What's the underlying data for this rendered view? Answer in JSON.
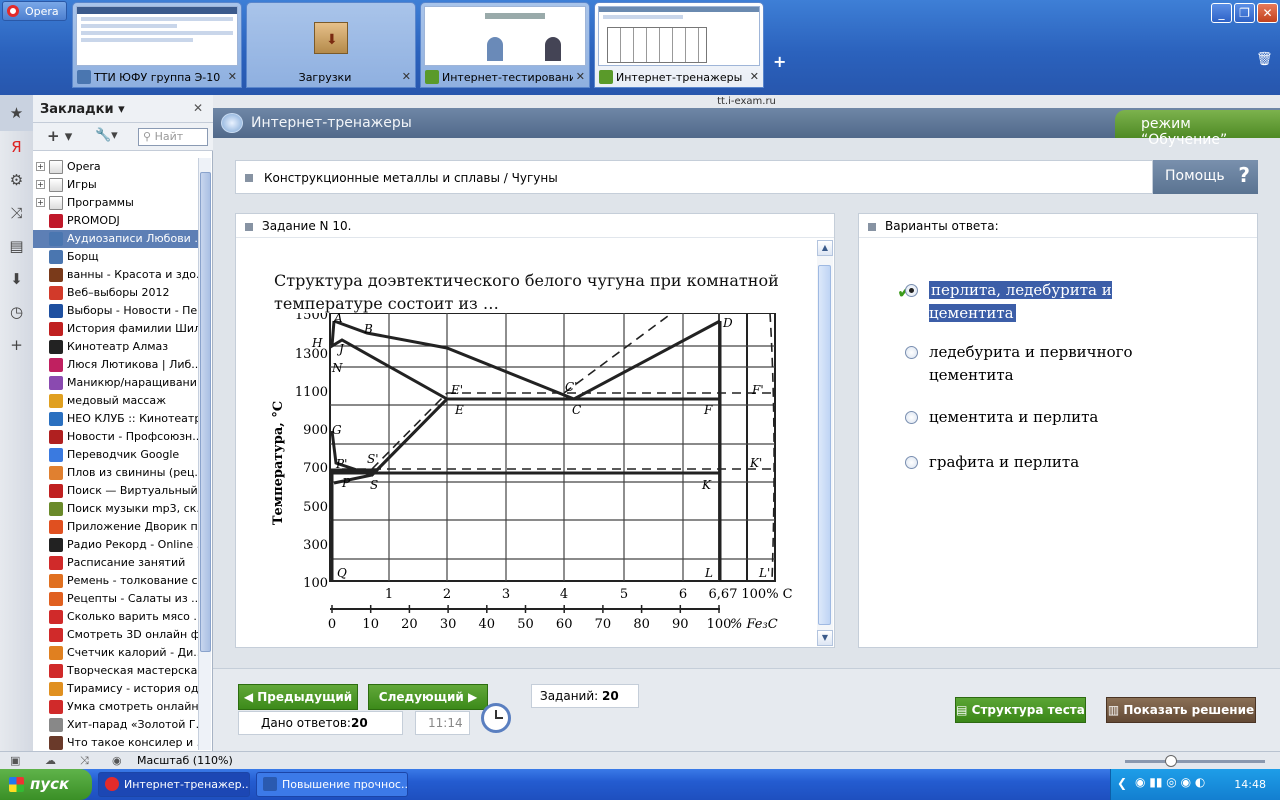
{
  "browser": {
    "menu_label": "Opera",
    "tabs": [
      {
        "title": "ТТИ ЮФУ группа Э-10",
        "fav_color": "#4a76b0"
      },
      {
        "title": "Загрузки",
        "fav_color": "#8a6a3a"
      },
      {
        "title": "Интернет-тестирование",
        "fav_color": "#5a9a2a"
      },
      {
        "title": "Интернет-тренажеры",
        "fav_color": "#5a9a2a"
      }
    ],
    "address": "tt.i-exam.ru",
    "zoom_label": "Масштаб (110%)"
  },
  "sidebar": {
    "title": "Закладки",
    "search_placeholder": "Найт",
    "bookmarks": [
      {
        "label": "Opera",
        "folder": true
      },
      {
        "label": "Игры",
        "folder": true
      },
      {
        "label": "Программы",
        "folder": true
      },
      {
        "label": "PROMODJ",
        "color": "#c0182a"
      },
      {
        "label": "Аудиозаписи Любови ...",
        "color": "#4a76b0",
        "selected": true
      },
      {
        "label": "Борщ",
        "color": "#4a76b0"
      },
      {
        "label": "ванны - Красота и здо...",
        "color": "#7a3a1a"
      },
      {
        "label": "Веб–выборы 2012",
        "color": "#d23a2a"
      },
      {
        "label": "Выборы - Новости - Пе...",
        "color": "#1e50a0"
      },
      {
        "label": "История фамилии Шил...",
        "color": "#c02020"
      },
      {
        "label": "Кинотеатр Алмаз",
        "color": "#222"
      },
      {
        "label": "Люся Лютикова | Либ...",
        "color": "#c02060"
      },
      {
        "label": "Маникюр/наращивани...",
        "color": "#8a4ab0"
      },
      {
        "label": "медовый массаж",
        "color": "#e0a020"
      },
      {
        "label": "НЕО КЛУБ :: Кинотеатр",
        "color": "#2a70c0"
      },
      {
        "label": "Новости - Профсоюзн...",
        "color": "#b02020"
      },
      {
        "label": "Переводчик Google",
        "color": "#3a7ae0"
      },
      {
        "label": "Плов из свинины (рец...",
        "color": "#e08030"
      },
      {
        "label": "Поиск — Виртуальный...",
        "color": "#c02020"
      },
      {
        "label": "Поиск музыки mp3, ск...",
        "color": "#6a8a2a"
      },
      {
        "label": "Приложение Дворик п...",
        "color": "#e05020"
      },
      {
        "label": "Радио Рекорд - Online ...",
        "color": "#222"
      },
      {
        "label": "Расписание занятий",
        "color": "#d02a2a"
      },
      {
        "label": "Ремень - толкование с...",
        "color": "#e07020"
      },
      {
        "label": "Рецепты - Салаты из ...",
        "color": "#e06020"
      },
      {
        "label": "Сколько варить мясо ...",
        "color": "#d02a2a"
      },
      {
        "label": "Смотреть 3D онлайн ф...",
        "color": "#d02a2a"
      },
      {
        "label": "Счетчик калорий - Ди...",
        "color": "#e08020"
      },
      {
        "label": "Творческая мастерска...",
        "color": "#d02a2a"
      },
      {
        "label": "Тирамису - история од...",
        "color": "#e09020"
      },
      {
        "label": "Умка смотреть онлайн...",
        "color": "#d02a2a"
      },
      {
        "label": "Хит-парад «Золотой Г...",
        "color": "#888"
      },
      {
        "label": "Что такое консилер и ...",
        "color": "#6a3a2a"
      }
    ]
  },
  "site": {
    "title": "Интернет-тренажеры",
    "mode": "режим “Обучение”",
    "topic": "Конструкционные металлы и сплавы / Чугуны",
    "help": "Помощь",
    "task_header": "Задание N 10.",
    "question": "Структура доэвтектического белого чугуна при комнатной температуре состоит из …",
    "answers_header": "Варианты ответа:",
    "options": [
      {
        "text": "перлита, ледебурита и цементита",
        "selected": true
      },
      {
        "text": "ледебурита и первичного цементита",
        "selected": false
      },
      {
        "text": "цементита и перлита",
        "selected": false
      },
      {
        "text": "графита и перлита",
        "selected": false
      }
    ],
    "prev": "Предыдущий",
    "next": "Следующий",
    "tasks_label": "Заданий:",
    "tasks_count": "20",
    "answered_label": "Дано ответов:",
    "answered_count": "20",
    "time": "11:14",
    "structure_btn": "Структура теста",
    "solution_btn": "Показать решение"
  },
  "diagram": {
    "y_label": "Температура, °С",
    "y_ticks": [
      "1500",
      "1300",
      "1100",
      "900",
      "700",
      "500",
      "300",
      "100"
    ],
    "c_ticks": [
      "1",
      "2",
      "3",
      "4",
      "5",
      "6",
      "6,67",
      "100% C"
    ],
    "fe3c_ticks": [
      "0",
      "10",
      "20",
      "30",
      "40",
      "50",
      "60",
      "70",
      "80",
      "90",
      "100"
    ],
    "fe3c_unit": "% Fe₃C",
    "points": [
      "A",
      "B",
      "H",
      "J",
      "N",
      "G",
      "P'",
      "P",
      "S'",
      "S",
      "E'",
      "E",
      "C'",
      "C",
      "F",
      "F'",
      "K",
      "K'",
      "D",
      "Q",
      "L",
      "L'"
    ]
  },
  "taskbar": {
    "start": "пуск",
    "items": [
      "Интернет-тренажер...",
      "Повышение прочнос..."
    ],
    "time": "14:48"
  }
}
